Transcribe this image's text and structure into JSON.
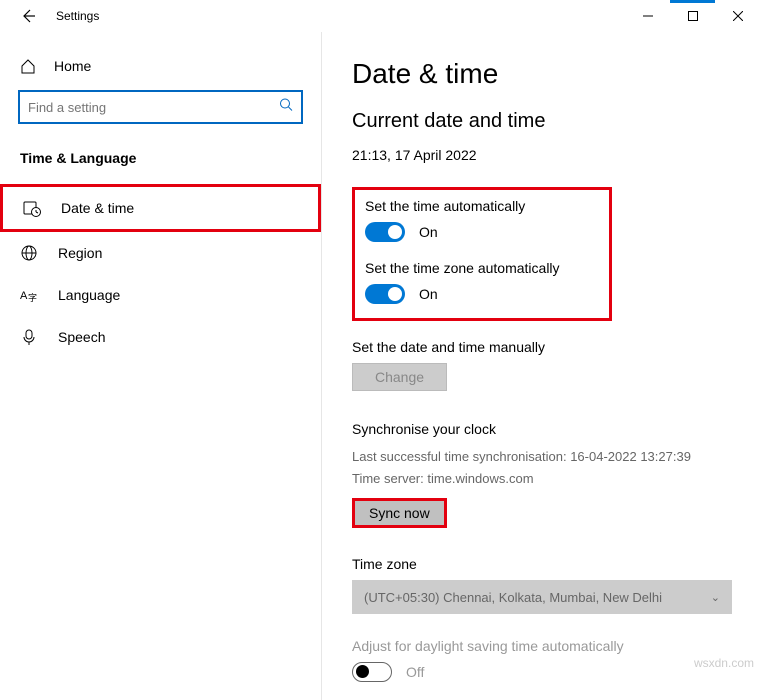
{
  "window": {
    "title": "Settings"
  },
  "home": {
    "label": "Home"
  },
  "search": {
    "placeholder": "Find a setting"
  },
  "section": {
    "title": "Time & Language"
  },
  "nav": {
    "date_time": "Date & time",
    "region": "Region",
    "language": "Language",
    "speech": "Speech"
  },
  "page": {
    "title": "Date & time",
    "subtitle": "Current date and time",
    "datetime": "21:13, 17 April 2022",
    "set_time_auto": {
      "label": "Set the time automatically",
      "state": "On"
    },
    "set_tz_auto": {
      "label": "Set the time zone automatically",
      "state": "On"
    },
    "manual": {
      "label": "Set the date and time manually",
      "button": "Change"
    },
    "sync": {
      "title": "Synchronise your clock",
      "last": "Last successful time synchronisation: 16-04-2022 13:27:39",
      "server": "Time server: time.windows.com",
      "button": "Sync now"
    },
    "tz": {
      "label": "Time zone",
      "value": "(UTC+05:30) Chennai, Kolkata, Mumbai, New Delhi"
    },
    "dst": {
      "label": "Adjust for daylight saving time automatically",
      "state": "Off"
    }
  },
  "watermark": "wsxdn.com"
}
